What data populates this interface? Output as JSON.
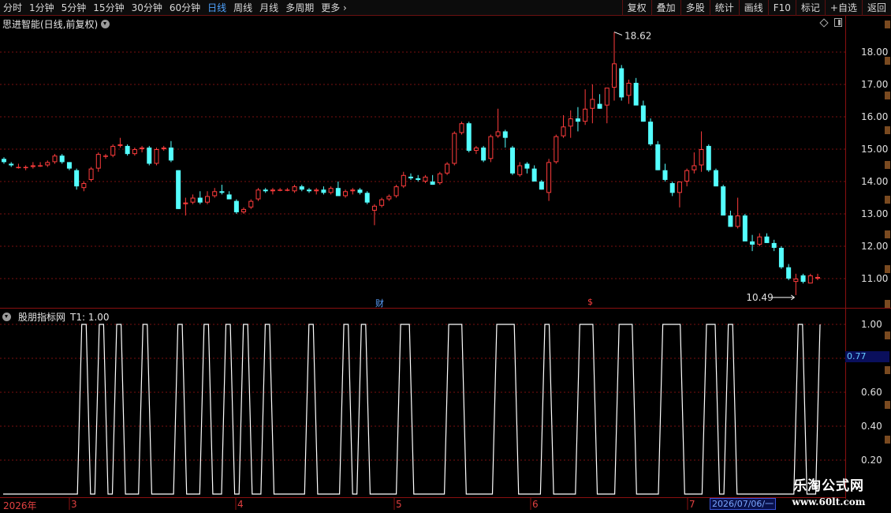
{
  "toolbar": {
    "periods": [
      "分时",
      "1分钟",
      "5分钟",
      "15分钟",
      "30分钟",
      "60分钟",
      "日线",
      "周线",
      "月线",
      "多周期",
      "更多"
    ],
    "active": "日线",
    "buttons": [
      "复权",
      "叠加",
      "多股",
      "统计",
      "画线",
      "F10",
      "标记",
      "+自选",
      "返回"
    ]
  },
  "chart_title": "思进智能(日线,前复权)",
  "main_axis": {
    "labels": [
      "18.00",
      "17.00",
      "16.00",
      "15.00",
      "14.00",
      "13.00",
      "12.00",
      "11.00"
    ],
    "values": [
      18,
      17,
      16,
      15,
      14,
      13,
      12,
      11
    ]
  },
  "annotations": {
    "high": "18.62",
    "low": "10.49"
  },
  "markers": {
    "cai": "财",
    "dollar": "$"
  },
  "indicator": {
    "name": "股朋指标网",
    "label": "T1: 1.00",
    "axis_labels": [
      "1.00",
      "0.60",
      "0.40",
      "0.20"
    ],
    "axis_values": [
      1.0,
      0.6,
      0.4,
      0.2
    ],
    "current_value": "0.77"
  },
  "x_axis": {
    "year": "2026年",
    "months": [
      "3",
      "4",
      "5",
      "6",
      "7"
    ],
    "cursor_date": "2026/07/06/一"
  },
  "watermark": {
    "line1": "乐淘公式网",
    "line2": "www.60lt.com"
  },
  "colors": {
    "up": "#ff3c3c",
    "down": "#54ffff",
    "grid": "#7a1010",
    "indicator": "#ffffff"
  },
  "chart_data": {
    "type": "candlestick",
    "candles": [
      [
        14.7,
        14.75,
        14.55,
        14.6
      ],
      [
        14.55,
        14.6,
        14.45,
        14.5
      ],
      [
        14.45,
        14.55,
        14.4,
        14.45
      ],
      [
        14.45,
        14.5,
        14.35,
        14.45
      ],
      [
        14.45,
        14.6,
        14.4,
        14.5
      ],
      [
        14.5,
        14.6,
        14.45,
        14.5
      ],
      [
        14.5,
        14.65,
        14.45,
        14.6
      ],
      [
        14.6,
        14.85,
        14.55,
        14.8
      ],
      [
        14.8,
        14.85,
        14.55,
        14.6
      ],
      [
        14.6,
        14.6,
        14.35,
        14.4
      ],
      [
        14.35,
        14.4,
        13.75,
        13.85
      ],
      [
        13.8,
        14.0,
        13.7,
        13.95
      ],
      [
        14.05,
        14.45,
        14.0,
        14.4
      ],
      [
        14.4,
        14.9,
        14.3,
        14.85
      ],
      [
        14.8,
        14.85,
        14.7,
        14.8
      ],
      [
        14.8,
        15.15,
        14.75,
        15.1
      ],
      [
        15.1,
        15.35,
        15.05,
        15.15
      ],
      [
        15.1,
        15.15,
        14.8,
        14.85
      ],
      [
        14.85,
        15.05,
        14.8,
        15.0
      ],
      [
        15.0,
        15.1,
        14.9,
        15.05
      ],
      [
        15.05,
        15.1,
        14.5,
        14.55
      ],
      [
        14.55,
        15.05,
        14.5,
        15.0
      ],
      [
        15.0,
        15.1,
        14.95,
        15.05
      ],
      [
        15.05,
        15.25,
        14.6,
        14.65
      ],
      [
        14.35,
        14.35,
        13.15,
        13.15
      ],
      [
        13.3,
        13.5,
        12.95,
        13.35
      ],
      [
        13.35,
        13.6,
        13.3,
        13.5
      ],
      [
        13.5,
        13.7,
        13.3,
        13.35
      ],
      [
        13.35,
        13.7,
        13.3,
        13.55
      ],
      [
        13.55,
        13.8,
        13.5,
        13.7
      ],
      [
        13.7,
        13.9,
        13.6,
        13.65
      ],
      [
        13.6,
        13.7,
        13.5,
        13.45
      ],
      [
        13.4,
        13.45,
        13.0,
        13.05
      ],
      [
        13.05,
        13.2,
        13.0,
        13.15
      ],
      [
        13.2,
        13.45,
        13.15,
        13.4
      ],
      [
        13.45,
        13.8,
        13.4,
        13.75
      ],
      [
        13.75,
        13.8,
        13.65,
        13.7
      ],
      [
        13.7,
        13.8,
        13.6,
        13.75
      ],
      [
        13.75,
        13.8,
        13.7,
        13.75
      ],
      [
        13.75,
        13.8,
        13.7,
        13.75
      ],
      [
        13.7,
        13.9,
        13.65,
        13.85
      ],
      [
        13.85,
        13.9,
        13.7,
        13.75
      ],
      [
        13.75,
        13.8,
        13.65,
        13.7
      ],
      [
        13.7,
        13.8,
        13.6,
        13.75
      ],
      [
        13.75,
        13.85,
        13.6,
        13.65
      ],
      [
        13.65,
        13.85,
        13.6,
        13.8
      ],
      [
        13.8,
        14.0,
        13.6,
        13.55
      ],
      [
        13.55,
        13.75,
        13.5,
        13.7
      ],
      [
        13.7,
        13.8,
        13.6,
        13.75
      ],
      [
        13.75,
        13.8,
        13.6,
        13.65
      ],
      [
        13.65,
        13.7,
        13.3,
        13.35
      ],
      [
        13.1,
        13.3,
        12.65,
        13.25
      ],
      [
        13.25,
        13.5,
        13.2,
        13.45
      ],
      [
        13.45,
        13.6,
        13.4,
        13.55
      ],
      [
        13.55,
        13.9,
        13.5,
        13.85
      ],
      [
        13.85,
        14.3,
        13.8,
        14.2
      ],
      [
        14.15,
        14.25,
        14.05,
        14.1
      ],
      [
        14.1,
        14.2,
        14.0,
        14.05
      ],
      [
        14.0,
        14.2,
        13.95,
        14.15
      ],
      [
        14.0,
        14.2,
        13.9,
        13.9
      ],
      [
        13.95,
        14.3,
        13.9,
        14.25
      ],
      [
        14.25,
        14.6,
        14.2,
        14.55
      ],
      [
        14.55,
        15.55,
        14.5,
        15.5
      ],
      [
        15.5,
        15.85,
        15.45,
        15.8
      ],
      [
        15.8,
        15.85,
        14.9,
        14.95
      ],
      [
        14.95,
        15.1,
        14.85,
        15.05
      ],
      [
        15.05,
        15.1,
        14.6,
        14.65
      ],
      [
        14.7,
        15.45,
        14.6,
        15.4
      ],
      [
        15.4,
        16.25,
        15.35,
        15.55
      ],
      [
        15.55,
        15.6,
        15.05,
        15.35
      ],
      [
        15.05,
        15.1,
        14.2,
        14.25
      ],
      [
        14.2,
        14.6,
        14.15,
        14.5
      ],
      [
        14.55,
        14.6,
        14.25,
        14.4
      ],
      [
        14.4,
        14.5,
        14.0,
        14.0
      ],
      [
        14.0,
        14.05,
        13.75,
        13.75
      ],
      [
        13.65,
        14.7,
        13.4,
        14.6
      ],
      [
        14.6,
        15.45,
        14.55,
        15.4
      ],
      [
        15.4,
        16.05,
        15.35,
        15.7
      ],
      [
        15.7,
        16.2,
        15.35,
        15.95
      ],
      [
        15.95,
        16.3,
        15.55,
        15.85
      ],
      [
        15.85,
        16.85,
        15.75,
        16.25
      ],
      [
        16.25,
        17.0,
        15.8,
        16.55
      ],
      [
        16.4,
        16.7,
        16.25,
        16.25
      ],
      [
        16.35,
        16.7,
        15.8,
        16.9
      ],
      [
        16.9,
        18.62,
        16.5,
        17.65
      ],
      [
        17.5,
        17.6,
        16.5,
        16.6
      ],
      [
        16.65,
        17.15,
        16.4,
        17.05
      ],
      [
        17.05,
        17.2,
        16.4,
        16.35
      ],
      [
        16.35,
        16.5,
        15.85,
        15.85
      ],
      [
        15.85,
        15.95,
        15.1,
        15.15
      ],
      [
        15.15,
        15.25,
        14.35,
        14.35
      ],
      [
        14.35,
        14.55,
        14.0,
        14.05
      ],
      [
        13.95,
        14.0,
        13.55,
        13.65
      ],
      [
        13.65,
        14.0,
        13.2,
        14.0
      ],
      [
        14.0,
        14.4,
        13.85,
        14.35
      ],
      [
        14.35,
        14.9,
        14.25,
        14.5
      ],
      [
        14.5,
        15.55,
        14.3,
        15.0
      ],
      [
        15.1,
        15.15,
        14.3,
        14.35
      ],
      [
        14.35,
        14.4,
        13.85,
        13.85
      ],
      [
        13.85,
        13.9,
        12.95,
        12.95
      ],
      [
        12.95,
        13.1,
        12.6,
        12.6
      ],
      [
        12.6,
        13.5,
        12.55,
        12.95
      ],
      [
        12.95,
        13.0,
        12.2,
        12.15
      ],
      [
        12.15,
        12.35,
        11.85,
        12.05
      ],
      [
        12.05,
        12.4,
        12.0,
        12.3
      ],
      [
        12.3,
        12.4,
        12.1,
        12.1
      ],
      [
        12.1,
        12.2,
        11.85,
        11.95
      ],
      [
        11.95,
        12.0,
        11.3,
        11.35
      ],
      [
        11.35,
        11.45,
        10.95,
        11.0
      ],
      [
        10.9,
        11.15,
        10.49,
        11.0
      ],
      [
        11.1,
        11.15,
        10.85,
        10.9
      ],
      [
        10.85,
        11.15,
        10.85,
        11.1
      ],
      [
        11.0,
        11.15,
        10.95,
        11.05
      ]
    ],
    "ylim": [
      10.0,
      19.0
    ],
    "indicator_series": [
      0,
      0,
      0,
      0,
      0,
      0,
      0,
      0,
      0,
      0,
      0,
      0,
      0,
      0,
      0,
      0,
      0,
      0,
      1,
      1,
      0,
      0,
      1,
      1,
      0,
      0,
      1,
      1,
      0,
      0,
      0,
      0,
      1,
      1,
      0,
      0,
      0,
      0,
      0,
      0,
      1,
      1,
      0,
      0,
      0,
      0,
      1,
      1,
      0,
      0,
      0,
      1,
      1,
      0,
      0,
      1,
      1,
      0,
      0,
      0,
      1,
      1,
      0,
      0,
      0,
      0,
      0,
      0,
      0,
      0,
      1,
      1,
      0,
      0,
      0,
      0,
      0,
      0,
      1,
      1,
      0,
      0,
      1,
      1,
      0,
      0,
      0,
      0,
      0,
      0,
      0,
      1,
      1,
      1,
      0,
      0,
      0,
      0,
      0,
      0,
      0,
      0,
      1,
      1,
      1,
      1,
      0,
      0,
      0,
      0,
      0,
      0,
      0,
      1,
      1,
      1,
      1,
      1,
      0,
      0,
      0,
      0,
      0,
      0,
      1,
      1,
      0,
      0,
      0,
      0,
      0,
      0,
      1,
      1,
      1,
      1,
      0,
      0,
      0,
      0,
      0,
      1,
      1,
      1,
      1,
      0,
      0,
      0,
      0,
      0,
      0,
      1,
      1,
      1,
      1,
      1,
      0,
      0,
      0,
      0,
      0,
      1,
      1,
      1,
      0,
      0,
      1,
      1,
      0,
      0,
      0,
      0,
      0,
      0,
      0,
      0,
      0,
      0,
      0,
      0,
      0,
      0,
      1,
      1,
      0,
      0,
      0,
      1
    ]
  }
}
